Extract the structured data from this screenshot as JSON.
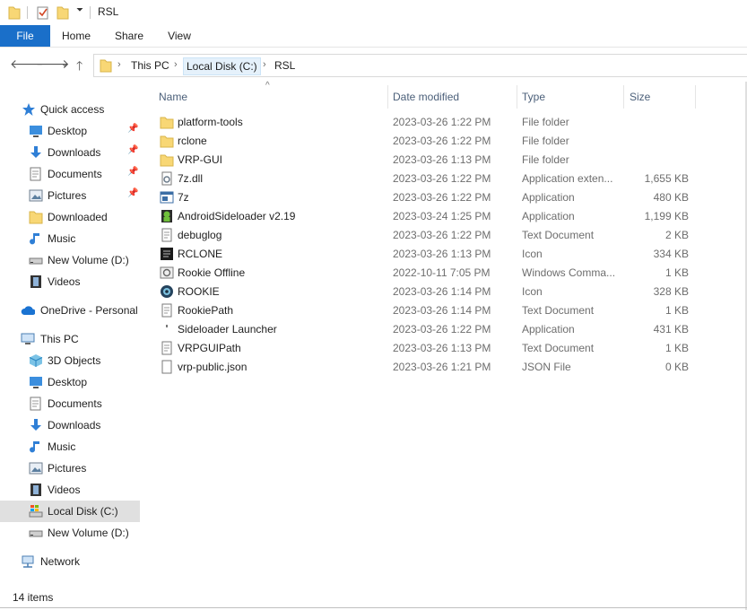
{
  "window": {
    "title": "RSL"
  },
  "ribbon": {
    "tabs": [
      "File",
      "Home",
      "Share",
      "View"
    ]
  },
  "address": {
    "crumbs": [
      "This PC",
      "Local Disk (C:)",
      "RSL"
    ]
  },
  "navigation": {
    "quick_access": "Quick access",
    "quick_items": [
      "Desktop",
      "Downloads",
      "Documents",
      "Pictures",
      "Downloaded",
      "Music",
      "New Volume (D:)",
      "Videos"
    ],
    "onedrive": "OneDrive - Personal",
    "this_pc": "This PC",
    "pc_items": [
      "3D Objects",
      "Desktop",
      "Documents",
      "Downloads",
      "Music",
      "Pictures",
      "Videos",
      "Local Disk (C:)",
      "New Volume (D:)"
    ],
    "network": "Network",
    "selected": "Local Disk (C:)"
  },
  "columns": {
    "name": "Name",
    "date": "Date modified",
    "type": "Type",
    "size": "Size"
  },
  "files": [
    {
      "name": "platform-tools",
      "date": "2023-03-26 1:22 PM",
      "type": "File folder",
      "size": "",
      "icon": "folder-icon"
    },
    {
      "name": "rclone",
      "date": "2023-03-26 1:22 PM",
      "type": "File folder",
      "size": "",
      "icon": "folder-icon"
    },
    {
      "name": "VRP-GUI",
      "date": "2023-03-26 1:13 PM",
      "type": "File folder",
      "size": "",
      "icon": "folder-icon"
    },
    {
      "name": "7z.dll",
      "date": "2023-03-26 1:22 PM",
      "type": "Application exten...",
      "size": "1,655 KB",
      "icon": "dll-icon"
    },
    {
      "name": "7z",
      "date": "2023-03-26 1:22 PM",
      "type": "Application",
      "size": "480 KB",
      "icon": "app-icon"
    },
    {
      "name": "AndroidSideloader v2.19",
      "date": "2023-03-24 1:25 PM",
      "type": "Application",
      "size": "1,199 KB",
      "icon": "android-icon"
    },
    {
      "name": "debuglog",
      "date": "2023-03-26 1:22 PM",
      "type": "Text Document",
      "size": "2 KB",
      "icon": "text-file-icon"
    },
    {
      "name": "RCLONE",
      "date": "2023-03-26 1:13 PM",
      "type": "Icon",
      "size": "334 KB",
      "icon": "rclone-icon"
    },
    {
      "name": "Rookie Offline",
      "date": "2022-10-11 7:05 PM",
      "type": "Windows Comma...",
      "size": "1 KB",
      "icon": "cmd-file-icon"
    },
    {
      "name": "ROOKIE",
      "date": "2023-03-26 1:14 PM",
      "type": "Icon",
      "size": "328 KB",
      "icon": "rookie-icon"
    },
    {
      "name": "RookiePath",
      "date": "2023-03-26 1:14 PM",
      "type": "Text Document",
      "size": "1 KB",
      "icon": "text-file-icon"
    },
    {
      "name": "Sideloader Launcher",
      "date": "2023-03-26 1:22 PM",
      "type": "Application",
      "size": "431 KB",
      "icon": "small-app-icon"
    },
    {
      "name": "VRPGUIPath",
      "date": "2023-03-26 1:13 PM",
      "type": "Text Document",
      "size": "1 KB",
      "icon": "text-file-icon"
    },
    {
      "name": "vrp-public.json",
      "date": "2023-03-26 1:21 PM",
      "type": "JSON File",
      "size": "0 KB",
      "icon": "blank-file-icon"
    }
  ],
  "status": {
    "items_text": "14 items"
  },
  "colors": {
    "accent": "#1a6fc9",
    "folder": "#f8d775",
    "selected": "#e0e0e0"
  }
}
